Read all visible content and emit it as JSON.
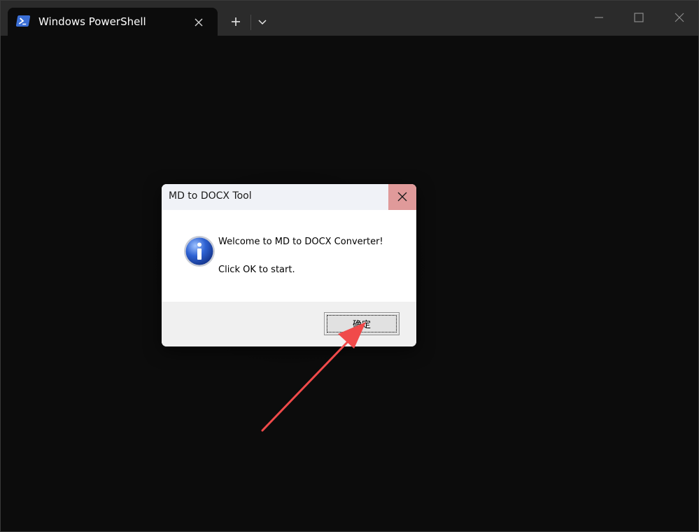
{
  "terminal": {
    "tab_title": "Windows PowerShell"
  },
  "dialog": {
    "title": "MD to DOCX Tool",
    "message_line1": "Welcome to MD to DOCX Converter!",
    "message_line2": "Click OK to start.",
    "ok_label": "确定",
    "icon": "info-icon"
  },
  "colors": {
    "terminal_bg": "#0c0c0c",
    "titlebar_bg": "#2b2b2b",
    "dialog_close_bg": "#e09a9a",
    "annotation_arrow": "#f04a4a"
  }
}
